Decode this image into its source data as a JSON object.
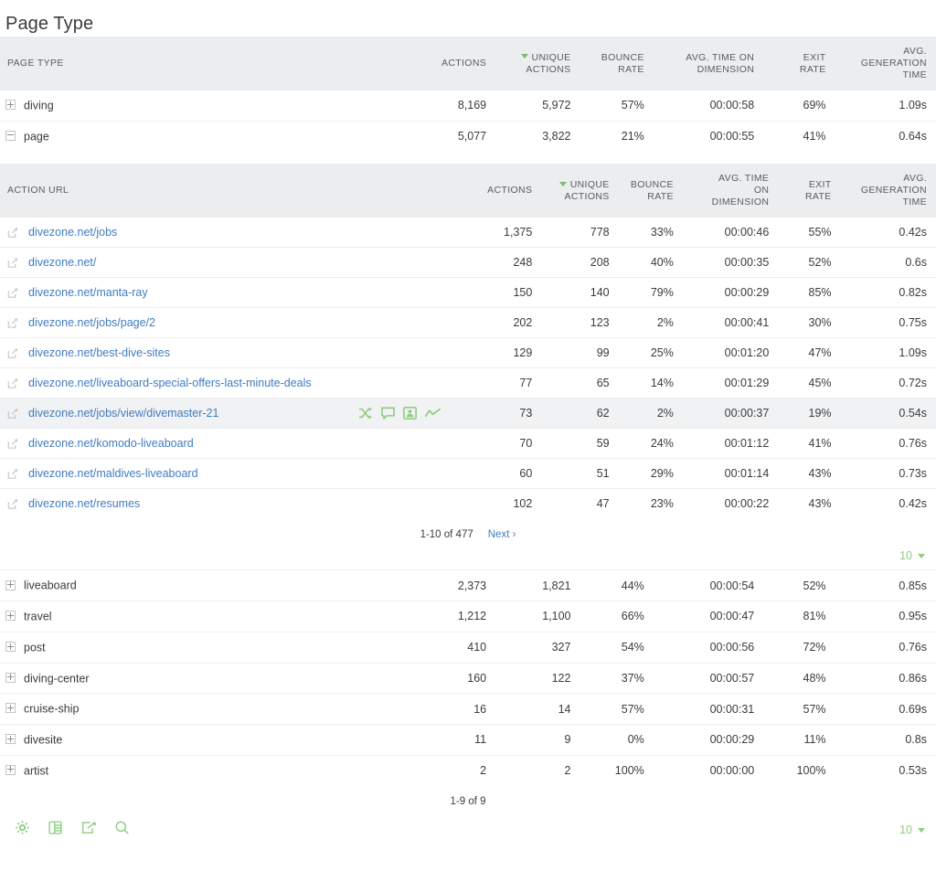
{
  "page": {
    "title": "Page Type"
  },
  "main_table": {
    "columns": [
      {
        "key": "label",
        "label": "PAGE TYPE",
        "sorted": false
      },
      {
        "key": "actions",
        "label": "ACTIONS",
        "sorted": false
      },
      {
        "key": "unique",
        "label": "UNIQUE ACTIONS",
        "sorted": true
      },
      {
        "key": "bounce",
        "label": "BOUNCE RATE",
        "sorted": false
      },
      {
        "key": "time",
        "label": "AVG. TIME ON DIMENSION",
        "sorted": false
      },
      {
        "key": "exit",
        "label": "EXIT RATE",
        "sorted": false
      },
      {
        "key": "gen",
        "label": "AVG. GENERATION TIME",
        "sorted": false
      }
    ],
    "header_lines": {
      "actions": [
        "ACTIONS"
      ],
      "unique": [
        "UNIQUE",
        "ACTIONS"
      ],
      "bounce": [
        "BOUNCE",
        "RATE"
      ],
      "time": [
        "AVG. TIME ON",
        "DIMENSION"
      ],
      "exit": [
        "EXIT",
        "RATE"
      ],
      "gen": [
        "AVG.",
        "GENERATION",
        "TIME"
      ]
    },
    "rows_top": [
      {
        "label": "diving",
        "expanded": false,
        "actions": "8,169",
        "unique": "5,972",
        "bounce": "57%",
        "time": "00:00:58",
        "exit": "69%",
        "gen": "1.09s"
      },
      {
        "label": "page",
        "expanded": true,
        "actions": "5,077",
        "unique": "3,822",
        "bounce": "21%",
        "time": "00:00:55",
        "exit": "41%",
        "gen": "0.64s"
      }
    ],
    "rows_bottom": [
      {
        "label": "liveaboard",
        "expanded": false,
        "actions": "2,373",
        "unique": "1,821",
        "bounce": "44%",
        "time": "00:00:54",
        "exit": "52%",
        "gen": "0.85s"
      },
      {
        "label": "travel",
        "expanded": false,
        "actions": "1,212",
        "unique": "1,100",
        "bounce": "66%",
        "time": "00:00:47",
        "exit": "81%",
        "gen": "0.95s"
      },
      {
        "label": "post",
        "expanded": false,
        "actions": "410",
        "unique": "327",
        "bounce": "54%",
        "time": "00:00:56",
        "exit": "72%",
        "gen": "0.76s"
      },
      {
        "label": "diving-center",
        "expanded": false,
        "actions": "160",
        "unique": "122",
        "bounce": "37%",
        "time": "00:00:57",
        "exit": "48%",
        "gen": "0.86s"
      },
      {
        "label": "cruise-ship",
        "expanded": false,
        "actions": "16",
        "unique": "14",
        "bounce": "57%",
        "time": "00:00:31",
        "exit": "57%",
        "gen": "0.69s"
      },
      {
        "label": "divesite",
        "expanded": false,
        "actions": "11",
        "unique": "9",
        "bounce": "0%",
        "time": "00:00:29",
        "exit": "11%",
        "gen": "0.8s"
      },
      {
        "label": "artist",
        "expanded": false,
        "actions": "2",
        "unique": "2",
        "bounce": "100%",
        "time": "00:00:00",
        "exit": "100%",
        "gen": "0.53s"
      }
    ],
    "footer": {
      "counter": "1-9 of 9",
      "limit_value": "10",
      "icons": [
        "gear-icon",
        "table-icon",
        "export-icon",
        "search-icon"
      ]
    }
  },
  "sub_table": {
    "header_lines": {
      "label": [
        "ACTION URL"
      ],
      "actions": [
        "ACTIONS"
      ],
      "unique": [
        "UNIQUE",
        "ACTIONS"
      ],
      "bounce": [
        "BOUNCE",
        "RATE"
      ],
      "time": [
        "AVG. TIME",
        "ON",
        "DIMENSION"
      ],
      "exit": [
        "EXIT",
        "RATE"
      ],
      "gen": [
        "AVG.",
        "GENERATION",
        "TIME"
      ]
    },
    "rows": [
      {
        "url": "divezone.net/jobs",
        "actions": "1,375",
        "unique": "778",
        "bounce": "33%",
        "time": "00:00:46",
        "exit": "55%",
        "gen": "0.42s",
        "hovered": false
      },
      {
        "url": "divezone.net/",
        "actions": "248",
        "unique": "208",
        "bounce": "40%",
        "time": "00:00:35",
        "exit": "52%",
        "gen": "0.6s",
        "hovered": false
      },
      {
        "url": "divezone.net/manta-ray",
        "actions": "150",
        "unique": "140",
        "bounce": "79%",
        "time": "00:00:29",
        "exit": "85%",
        "gen": "0.82s",
        "hovered": false
      },
      {
        "url": "divezone.net/jobs/page/2",
        "actions": "202",
        "unique": "123",
        "bounce": "2%",
        "time": "00:00:41",
        "exit": "30%",
        "gen": "0.75s",
        "hovered": false
      },
      {
        "url": "divezone.net/best-dive-sites",
        "actions": "129",
        "unique": "99",
        "bounce": "25%",
        "time": "00:01:20",
        "exit": "47%",
        "gen": "1.09s",
        "hovered": false
      },
      {
        "url": "divezone.net/liveaboard-special-offers-last-minute-deals",
        "actions": "77",
        "unique": "65",
        "bounce": "14%",
        "time": "00:01:29",
        "exit": "45%",
        "gen": "0.72s",
        "hovered": false
      },
      {
        "url": "divezone.net/jobs/view/divemaster-21",
        "actions": "73",
        "unique": "62",
        "bounce": "2%",
        "time": "00:00:37",
        "exit": "19%",
        "gen": "0.54s",
        "hovered": true
      },
      {
        "url": "divezone.net/komodo-liveaboard",
        "actions": "70",
        "unique": "59",
        "bounce": "24%",
        "time": "00:01:12",
        "exit": "41%",
        "gen": "0.76s",
        "hovered": false
      },
      {
        "url": "divezone.net/maldives-liveaboard",
        "actions": "60",
        "unique": "51",
        "bounce": "29%",
        "time": "00:01:14",
        "exit": "43%",
        "gen": "0.73s",
        "hovered": false
      },
      {
        "url": "divezone.net/resumes",
        "actions": "102",
        "unique": "47",
        "bounce": "23%",
        "time": "00:00:22",
        "exit": "43%",
        "gen": "0.42s",
        "hovered": false
      }
    ],
    "row_action_icons": [
      "transitions-icon",
      "segmented-visits-log-icon",
      "visitor-profile-icon",
      "row-evolution-icon"
    ],
    "pagination": {
      "counter": "1-10 of 477",
      "next_label": "Next ›",
      "limit_value": "10"
    }
  },
  "colors": {
    "header_bg": "#ebedef",
    "link": "#417cc1",
    "accent_green": "#8fcc7f",
    "sort_green": "#7bbd6a",
    "hover_bg": "#f1f2f3",
    "text": "#3b3b3b",
    "border": "#eeeff0"
  }
}
